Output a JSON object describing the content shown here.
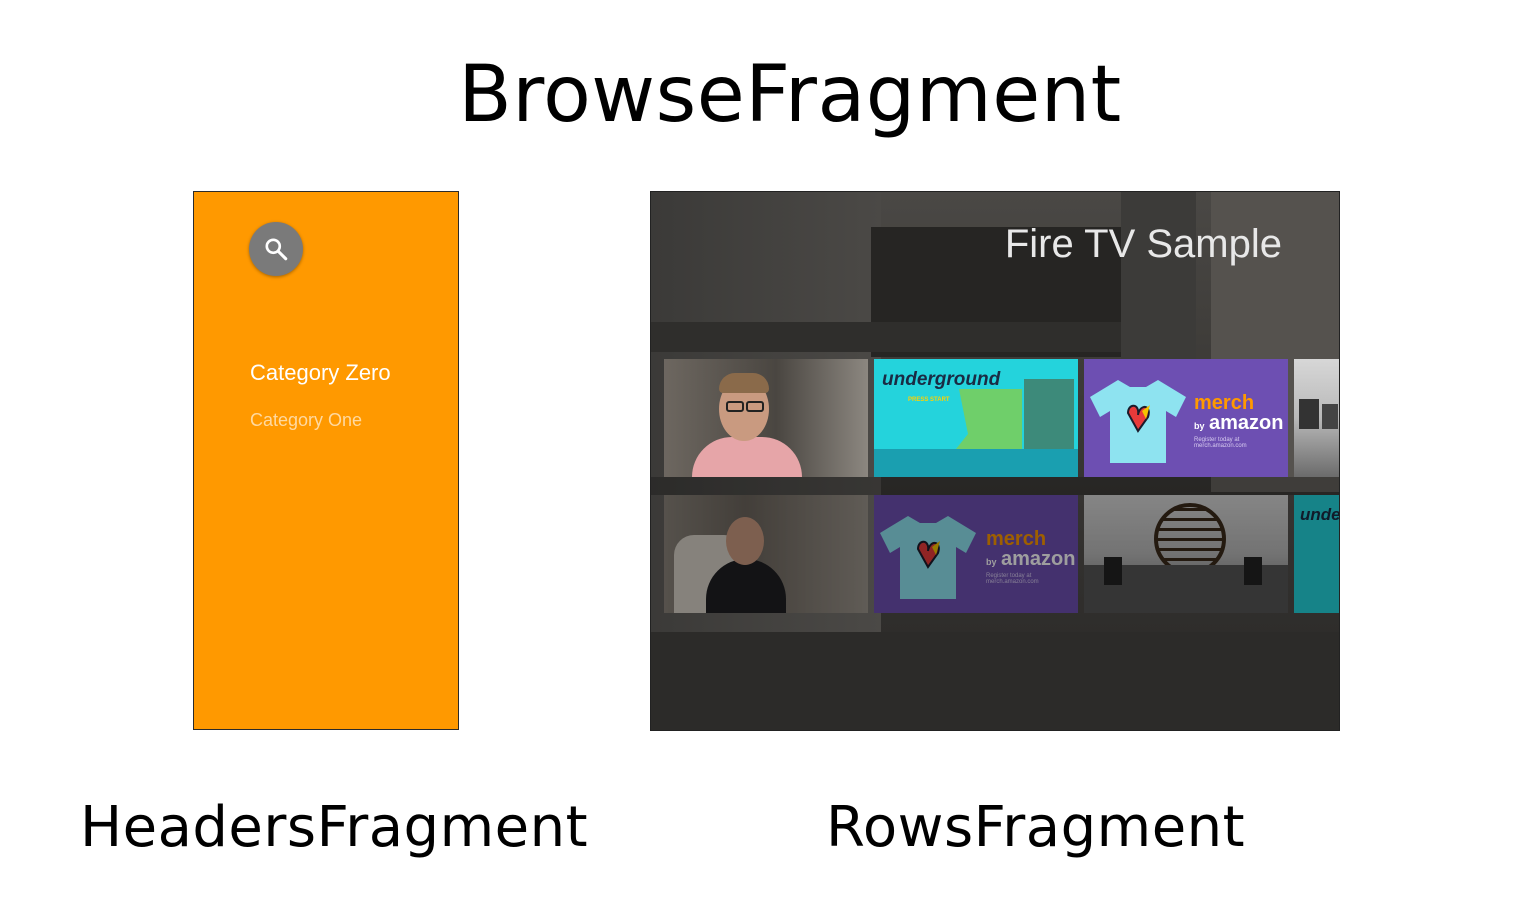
{
  "title": "BrowseFragment",
  "headers_fragment": {
    "label": "HeadersFragment",
    "panel_color": "#ff9900",
    "search_icon": "search-icon",
    "categories": [
      "Category Zero",
      "Category One"
    ]
  },
  "rows_fragment": {
    "label": "RowsFragment",
    "app_title": "Fire TV Sample",
    "row_1_cards": [
      "video-person-glasses",
      "underground",
      "merch-by-amazon",
      "orchestra"
    ],
    "row_2_cards": [
      "video-person-seated",
      "merch-by-amazon",
      "orchestra",
      "underground"
    ],
    "card_text": {
      "underground": "underground",
      "underground_sub": "PRESS START",
      "merch": "merch",
      "by": "by",
      "amazon": "amazon",
      "merch_sub": "Register today at merch.amazon.com",
      "underground_partial": "unde"
    }
  }
}
